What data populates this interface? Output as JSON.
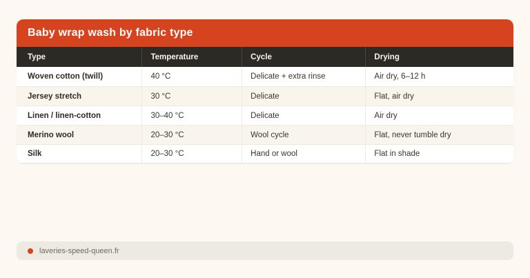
{
  "card": {
    "title": "Baby wrap wash by fabric type"
  },
  "table": {
    "columns": [
      "Type",
      "Temperature",
      "Cycle",
      "Drying"
    ],
    "rows": [
      [
        "Woven cotton (twill)",
        "40 °C",
        "Delicate + extra rinse",
        "Air dry, 6–12 h"
      ],
      [
        "Jersey stretch",
        "30 °C",
        "Delicate",
        "Flat, air dry"
      ],
      [
        "Linen / linen-cotton",
        "30–40 °C",
        "Delicate",
        "Air dry"
      ],
      [
        "Merino wool",
        "20–30 °C",
        "Wool cycle",
        "Flat, never tumble dry"
      ],
      [
        "Silk",
        "20–30 °C",
        "Hand or wool",
        "Flat in shade"
      ]
    ]
  },
  "footer": {
    "source": "laveries-speed-queen.fr"
  },
  "colors": {
    "accent": "#d5431f",
    "header_dark": "#2d2a26",
    "page_bg": "#fdf9f2",
    "row_stripe": "#faf5ec",
    "chip_bg": "#edeae1"
  },
  "chart_data": {
    "type": "table",
    "title": "Baby wrap wash by fabric type",
    "columns": [
      "Type",
      "Temperature",
      "Cycle",
      "Drying"
    ],
    "rows": [
      [
        "Woven cotton (twill)",
        "40 °C",
        "Delicate + extra rinse",
        "Air dry, 6–12 h"
      ],
      [
        "Jersey stretch",
        "30 °C",
        "Delicate",
        "Flat, air dry"
      ],
      [
        "Linen / linen-cotton",
        "30–40 °C",
        "Delicate",
        "Air dry"
      ],
      [
        "Merino wool",
        "20–30 °C",
        "Wool cycle",
        "Flat, never tumble dry"
      ],
      [
        "Silk",
        "20–30 °C",
        "Hand or wool",
        "Flat in shade"
      ]
    ],
    "source": "laveries-speed-queen.fr"
  }
}
